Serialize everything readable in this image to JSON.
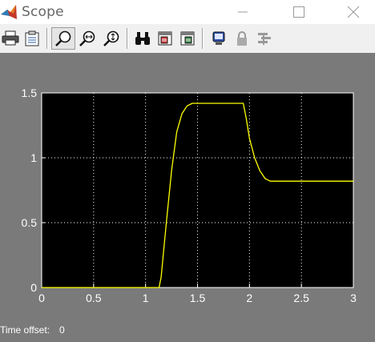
{
  "window": {
    "title": "Scope"
  },
  "toolbar": {
    "buttons": [
      {
        "name": "print-icon"
      },
      {
        "name": "parameters-icon"
      },
      {
        "name": "zoom-icon",
        "active": true
      },
      {
        "name": "zoom-x-icon"
      },
      {
        "name": "zoom-y-icon"
      },
      {
        "name": "autoscale-binoculars-icon"
      },
      {
        "name": "save-axes-settings-icon"
      },
      {
        "name": "restore-axes-settings-icon"
      },
      {
        "name": "floating-scope-icon"
      },
      {
        "name": "lock-axes-icon"
      },
      {
        "name": "signal-selector-icon"
      }
    ]
  },
  "footer": {
    "time_offset_label": "Time offset:",
    "time_offset_value": "0"
  },
  "colors": {
    "plot_bg": "#000000",
    "frame_bg": "#7a7a7a",
    "trace": "#ffff00",
    "grid": "#ffffff"
  },
  "chart_data": {
    "type": "line",
    "title": "",
    "xlabel": "",
    "ylabel": "",
    "xlim": [
      0,
      3
    ],
    "ylim": [
      0,
      1.5
    ],
    "xticks": [
      "0",
      "0.5",
      "1",
      "1.5",
      "2",
      "2.5",
      "3"
    ],
    "yticks": [
      "0",
      "0.5",
      "1",
      "1.5"
    ],
    "grid": true,
    "series": [
      {
        "x": [
          0,
          1.13,
          1.15,
          1.2,
          1.25,
          1.3,
          1.35,
          1.4,
          1.45,
          1.5,
          1.55,
          1.6,
          1.65,
          1.7,
          1.75,
          1.8,
          1.85,
          1.9,
          1.94,
          1.97,
          2.0,
          2.05,
          2.1,
          2.15,
          2.2,
          2.25,
          2.3,
          2.4,
          2.6,
          2.8,
          3.0
        ],
        "y": [
          0,
          0,
          0.08,
          0.5,
          0.9,
          1.2,
          1.34,
          1.4,
          1.42,
          1.42,
          1.42,
          1.42,
          1.42,
          1.42,
          1.42,
          1.42,
          1.42,
          1.42,
          1.42,
          1.3,
          1.15,
          1.0,
          0.9,
          0.84,
          0.82,
          0.82,
          0.82,
          0.82,
          0.82,
          0.82,
          0.82
        ]
      }
    ]
  }
}
